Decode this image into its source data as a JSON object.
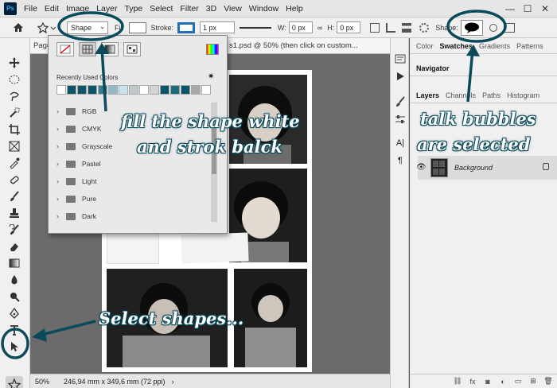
{
  "menu": {
    "app_icon": "Ps",
    "items": [
      "File",
      "Edit",
      "Image",
      "Layer",
      "Type",
      "Select",
      "Filter",
      "3D",
      "View",
      "Window",
      "Help"
    ],
    "window_controls": [
      "—",
      "☐",
      "✕"
    ]
  },
  "options_bar": {
    "mode_value": "Shape",
    "fill_label": "Fill",
    "stroke_label": "Stroke:",
    "stroke_width": "1 px",
    "w_label": "W:",
    "w_value": "0 px",
    "h_label": "H:",
    "h_value": "0 px",
    "shape_label": "Shape:",
    "fill_color": "#ffffff",
    "stroke_color": "#1e6eb8"
  },
  "document": {
    "tab_left": "Page",
    "tab_title": "s1.psd @ 50% (then click on custom...",
    "zoom": "50%",
    "dimensions": "246,94 mm x 349,6 mm (72 ppi)"
  },
  "fill_popup": {
    "recent_title": "Recently Used Colors",
    "recent_colors": [
      "#ffffff",
      "#0d5566",
      "#0d5566",
      "#0d5566",
      "#3a7e8f",
      "#8fb9c4",
      "#c8e3ec",
      "#bfc9cc",
      "#ffffff",
      "#d4d4d4",
      "#0d5566",
      "#1b6b7a",
      "#0d5566",
      "#a8a8a8",
      "#ffffff",
      "#ffffff",
      "#d8d8d8"
    ],
    "folders": [
      "RGB",
      "CMYK",
      "Grayscale",
      "Pastel",
      "Light",
      "Pure",
      "Dark"
    ]
  },
  "panels": {
    "top_tabs": [
      "Color",
      "Swatches",
      "Gradients",
      "Patterns"
    ],
    "navigator_tab": "Navigator",
    "layer_tabs": [
      "Layers",
      "Channels",
      "Paths",
      "Histogram"
    ],
    "layer_name": "Background"
  },
  "annotations": {
    "fill_note_line1": "fill the shape white",
    "fill_note_line2": "and strok balck",
    "bubble_note_line1": "talk bubbles",
    "bubble_note_line2": "are selected",
    "select_note": "Select shapes..."
  },
  "colors": {
    "annotation": "#0b4a5a",
    "ui_bg": "#f0f0f0",
    "canvas_bg": "#6b6b6b"
  }
}
